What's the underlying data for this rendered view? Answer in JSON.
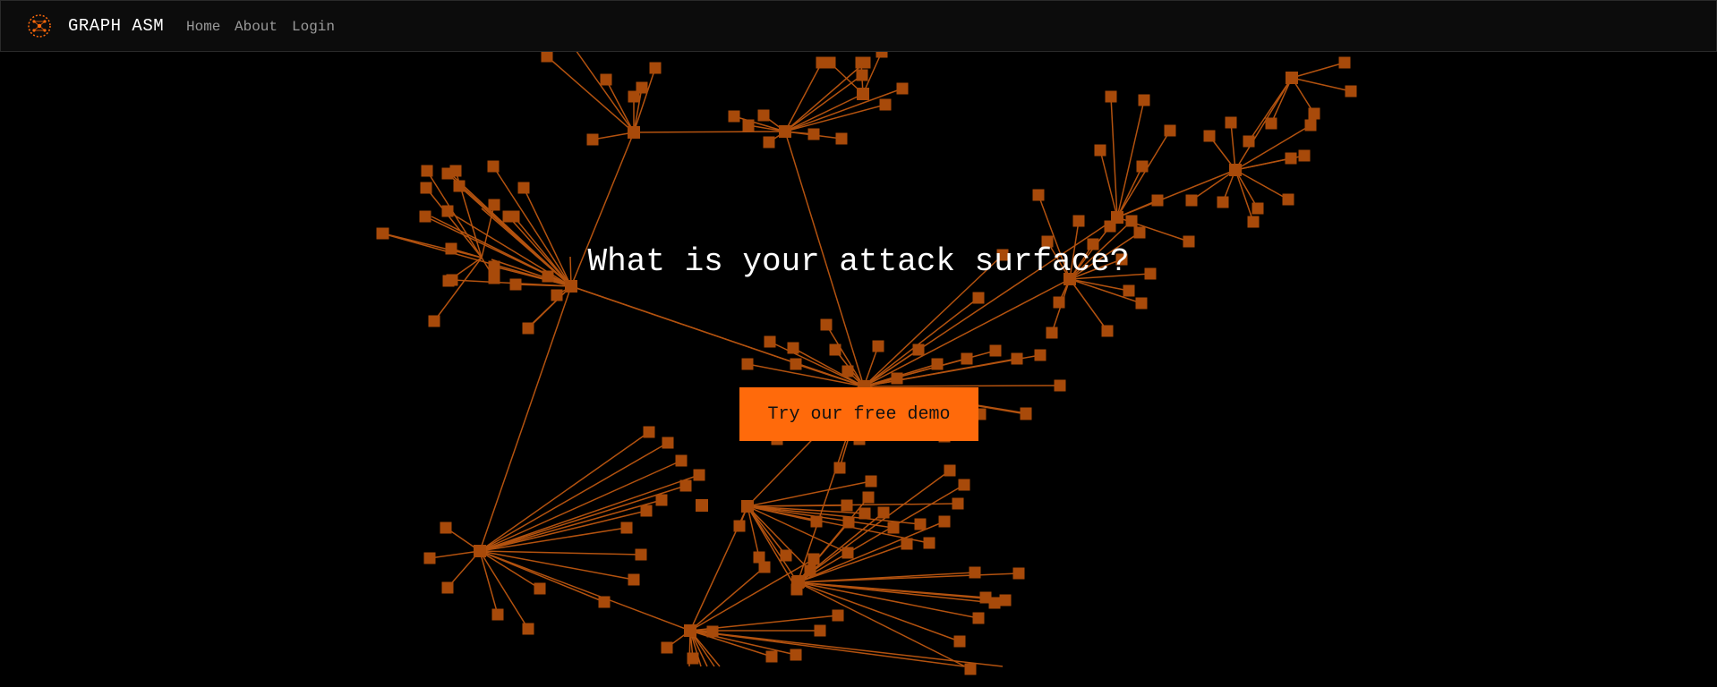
{
  "nav": {
    "brand": "GRAPH ASM",
    "links": [
      {
        "label": "Home"
      },
      {
        "label": "About"
      },
      {
        "label": "Login"
      }
    ]
  },
  "hero": {
    "title": "What is your attack surface?",
    "cta_label": "Try our free demo"
  },
  "colors": {
    "accent": "#ff6a0b",
    "node": "#a84a0a",
    "edge": "#b3520f",
    "background": "#000000"
  },
  "icons": {
    "logo": "graph-network-logo-icon"
  }
}
